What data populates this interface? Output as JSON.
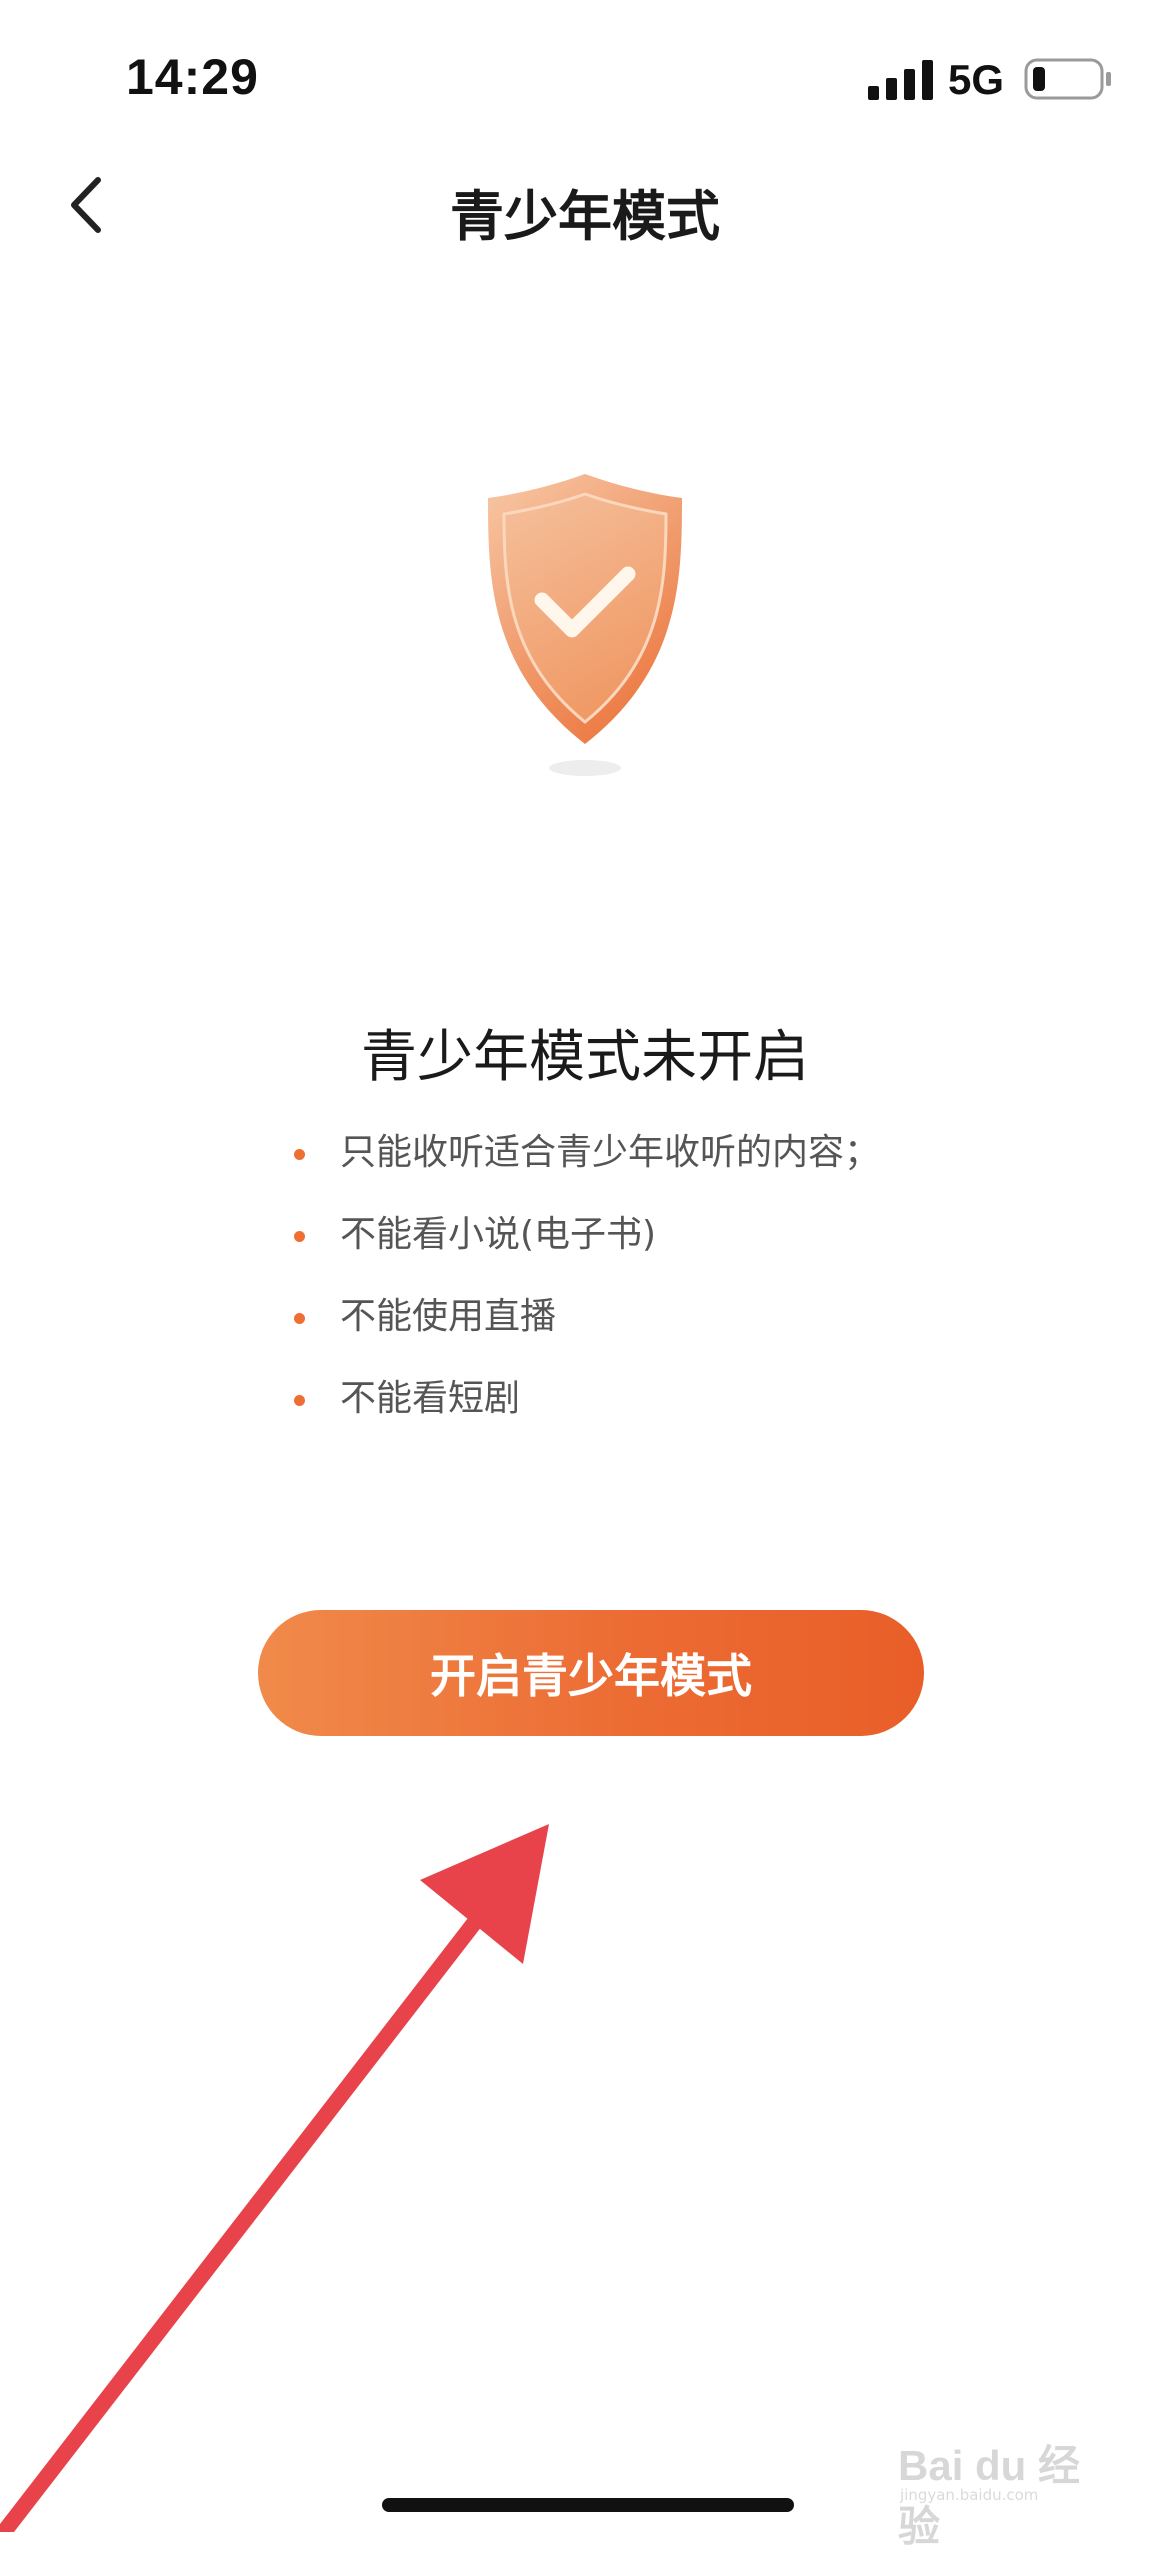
{
  "status_bar": {
    "time": "14:29",
    "network": "5G",
    "icons": [
      "signal-icon",
      "battery-icon"
    ]
  },
  "nav": {
    "back_icon": "chevron-left-icon",
    "title": "青少年模式"
  },
  "illustration": {
    "icon": "shield-check-icon",
    "colors": {
      "shield_light": "#f6c4a2",
      "shield_dark": "#ec7d45",
      "check": "#fff6ec"
    }
  },
  "status": {
    "heading": "青少年模式未开启",
    "features": [
      "只能收听适合青少年收听的内容；",
      "不能看小说(电子书)",
      "不能使用直播",
      "不能看短剧"
    ]
  },
  "action": {
    "enable_label": "开启青少年模式",
    "accent_color": "#ec6c34"
  },
  "annotation": {
    "icon": "red-arrow-icon",
    "color": "#e8434a"
  },
  "watermark": {
    "logo": "Bai du 经验",
    "sub": "jingyan.baidu.com"
  }
}
